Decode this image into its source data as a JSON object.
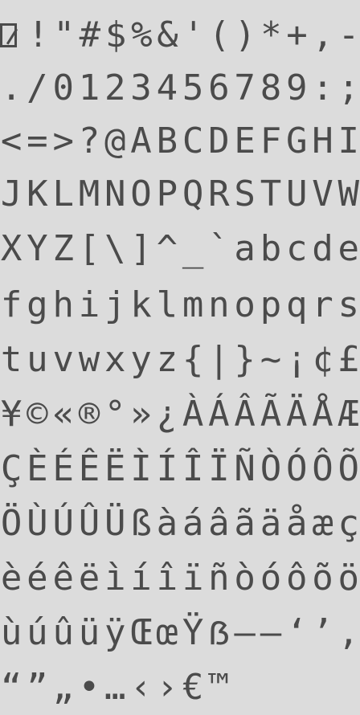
{
  "glyph_sheet": {
    "rows": [
      [
        "",
        "!",
        "\"",
        "#",
        "$",
        "%",
        "&",
        "'",
        "(",
        ")",
        "*",
        "+",
        ",",
        "-"
      ],
      [
        ".",
        "/",
        "0",
        "1",
        "2",
        "3",
        "4",
        "5",
        "6",
        "7",
        "8",
        "9",
        ":",
        ";"
      ],
      [
        "<",
        "=",
        ">",
        "?",
        "@",
        "A",
        "B",
        "C",
        "D",
        "E",
        "F",
        "G",
        "H",
        "I"
      ],
      [
        "J",
        "K",
        "L",
        "M",
        "N",
        "O",
        "P",
        "Q",
        "R",
        "S",
        "T",
        "U",
        "V",
        "W"
      ],
      [
        "X",
        "Y",
        "Z",
        "[",
        "\\",
        "]",
        "^",
        "_",
        "`",
        "a",
        "b",
        "c",
        "d",
        "e"
      ],
      [
        "f",
        "g",
        "h",
        "i",
        "j",
        "k",
        "l",
        "m",
        "n",
        "o",
        "p",
        "q",
        "r",
        "s"
      ],
      [
        "t",
        "u",
        "v",
        "w",
        "x",
        "y",
        "z",
        "{",
        "|",
        "}",
        "~",
        "¡",
        "¢",
        "£"
      ],
      [
        "¥",
        "©",
        "«",
        "®",
        "°",
        "»",
        "¿",
        "À",
        "Á",
        "Â",
        "Ã",
        "Ä",
        "Å",
        "Æ"
      ],
      [
        "Ç",
        "È",
        "É",
        "Ê",
        "Ë",
        "Ì",
        "Í",
        "Î",
        "Ï",
        "Ñ",
        "Ò",
        "Ó",
        "Ô",
        "Õ"
      ],
      [
        "Ö",
        "Ù",
        "Ú",
        "Û",
        "Ü",
        "ß",
        "à",
        "á",
        "â",
        "ã",
        "ä",
        "å",
        "æ",
        "ç"
      ],
      [
        "è",
        "é",
        "ê",
        "ë",
        "ì",
        "í",
        "î",
        "ï",
        "ñ",
        "ò",
        "ó",
        "ô",
        "õ",
        "ö"
      ],
      [
        "ù",
        "ú",
        "û",
        "ü",
        "ÿ",
        "Œ",
        "œ",
        "Ÿ",
        "ẞ",
        "–",
        "—",
        "‘",
        "’",
        "‚"
      ],
      [
        "“",
        "”",
        "„",
        "•",
        "…",
        "‹",
        "›",
        "€",
        "™",
        "",
        "",
        "",
        "",
        ""
      ]
    ],
    "colors": {
      "background": "#dcdcdc",
      "glyph": "#4b4b4b"
    }
  }
}
